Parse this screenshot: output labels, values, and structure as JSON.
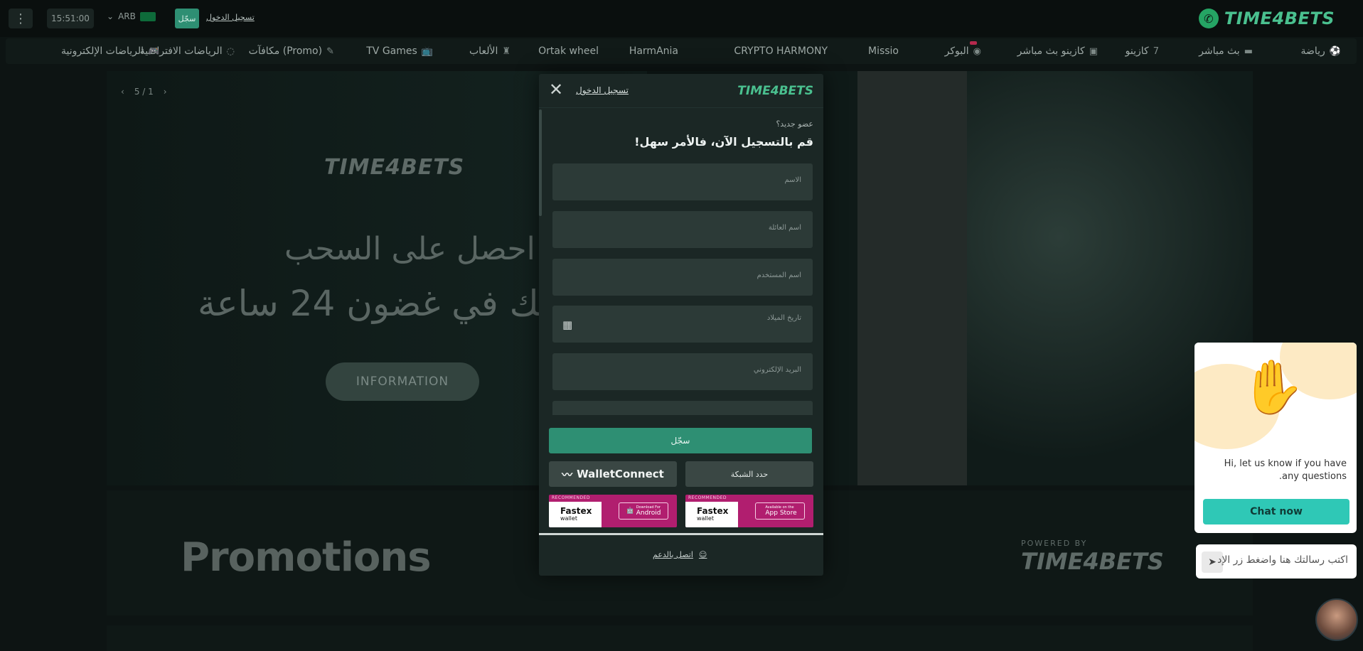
{
  "header": {
    "clock": "15:51:00",
    "language": "ARB",
    "register_label": "سجّل",
    "login_label": "تسجيل الدخول",
    "brand": "TIME4BETS",
    "menu_icon": "kebab-menu-icon",
    "whatsapp_icon": "whatsapp-icon"
  },
  "nav": {
    "items": [
      {
        "label": "رياضة",
        "icon": "soccer-icon"
      },
      {
        "label": "بث مباشر",
        "icon": "live-icon"
      },
      {
        "label": "كازينو",
        "icon": "seven-icon"
      },
      {
        "label": "كازينو بث مباشر",
        "icon": "dealer-icon"
      },
      {
        "label": "البوكر",
        "icon": "poker-chip-icon"
      },
      {
        "label": "Missio",
        "icon": ""
      },
      {
        "label": "CRYPTO HARMONY",
        "icon": ""
      },
      {
        "label": "HarmAnia",
        "icon": ""
      },
      {
        "label": "Ortak wheel",
        "icon": ""
      },
      {
        "label": "الألعاب",
        "icon": "chess-icon"
      },
      {
        "label": "TV Games",
        "icon": "tv-icon"
      },
      {
        "label": "مكافآت (Promo)",
        "icon": "gift-icon"
      },
      {
        "label": "الرياضات الافتراضية",
        "icon": "virtual-icon"
      },
      {
        "label": "الرياضات الإلكترونية",
        "icon": "gamepad-icon"
      }
    ]
  },
  "hero": {
    "slide_counter": "5 / 1",
    "brand": "TIME4BETS",
    "line1": "احصل على السحب",
    "line2": "ص بك في غضون 24 ساعة",
    "info_button": "INFORMATION"
  },
  "promotions": {
    "title": "Promotions",
    "powered_label": "POWERED BY",
    "powered_brand": "TIME4BETS"
  },
  "modal": {
    "login_link": "تسجيل الدخول",
    "brand": "TIME4BETS",
    "new_member": "عضو جديد؟",
    "headline": "قم بالتسجيل الآن، فالأمر سهل!",
    "fields": {
      "name": "الاسم",
      "family_name": "اسم العائلة",
      "username": "اسم المستخدم",
      "birth_date": "تاريخ الميلاد",
      "email": "البريد الإلكتروني"
    },
    "submit_label": "سجّل",
    "wallet_label": "WalletConnect",
    "network_label": "حدد الشبكة",
    "apps": [
      {
        "recommended": "RECOMMENDED",
        "name": "Fastex",
        "sub": "wallet",
        "store_small": "Download For",
        "store": "Android"
      },
      {
        "recommended": "RECOMMENDED",
        "name": "Fastex",
        "sub": "wallet",
        "store_small": "Available on the",
        "store": "App Store"
      }
    ],
    "support_label": "اتصل بالدعم"
  },
  "chat": {
    "message": "Hi, let us know if you have any questions.",
    "button": "Chat now",
    "input_placeholder": "اكتب رسالتك هنا واضغط زر الإد"
  }
}
